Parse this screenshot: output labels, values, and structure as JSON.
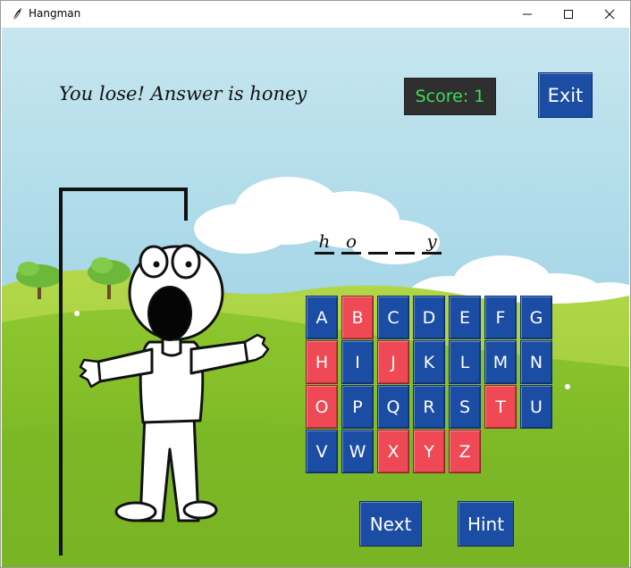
{
  "window": {
    "title": "Hangman",
    "minimize_icon": "minimize-icon",
    "maximize_icon": "maximize-icon",
    "close_icon": "close-icon"
  },
  "game": {
    "status_message": "You lose! Answer is honey",
    "score_label": "Score: 1",
    "exit_label": "Exit",
    "next_label": "Next",
    "hint_label": "Hint",
    "word_slots": [
      "h",
      "o",
      "",
      "",
      "y"
    ]
  },
  "keyboard": {
    "keys": [
      {
        "letter": "A",
        "state": "unused"
      },
      {
        "letter": "B",
        "state": "guessed"
      },
      {
        "letter": "C",
        "state": "unused"
      },
      {
        "letter": "D",
        "state": "unused"
      },
      {
        "letter": "E",
        "state": "unused"
      },
      {
        "letter": "F",
        "state": "unused"
      },
      {
        "letter": "G",
        "state": "unused"
      },
      {
        "letter": "H",
        "state": "guessed"
      },
      {
        "letter": "I",
        "state": "unused"
      },
      {
        "letter": "J",
        "state": "guessed"
      },
      {
        "letter": "K",
        "state": "unused"
      },
      {
        "letter": "L",
        "state": "unused"
      },
      {
        "letter": "M",
        "state": "unused"
      },
      {
        "letter": "N",
        "state": "unused"
      },
      {
        "letter": "O",
        "state": "guessed"
      },
      {
        "letter": "P",
        "state": "unused"
      },
      {
        "letter": "Q",
        "state": "unused"
      },
      {
        "letter": "R",
        "state": "unused"
      },
      {
        "letter": "S",
        "state": "unused"
      },
      {
        "letter": "T",
        "state": "guessed"
      },
      {
        "letter": "U",
        "state": "unused"
      },
      {
        "letter": "V",
        "state": "unused"
      },
      {
        "letter": "W",
        "state": "unused"
      },
      {
        "letter": "X",
        "state": "guessed"
      },
      {
        "letter": "Y",
        "state": "guessed"
      },
      {
        "letter": "Z",
        "state": "guessed"
      }
    ]
  },
  "colors": {
    "key_unused": "#1b4da5",
    "key_guessed": "#ef4955",
    "score_text": "#3dde59",
    "score_bg": "#2e2f2e",
    "sky_top": "#b9dfea",
    "grass": "#86bf2a"
  }
}
